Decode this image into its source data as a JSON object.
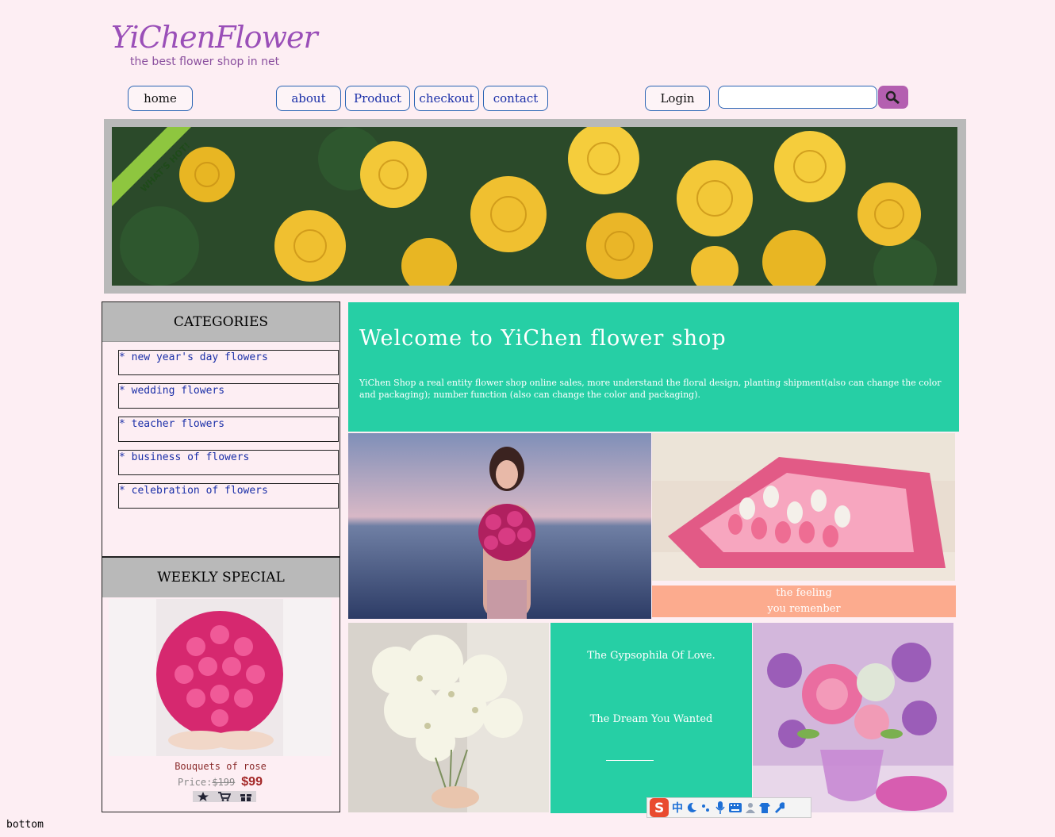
{
  "logo": {
    "title": "YiChenFlower",
    "subtitle": "the best flower shop in net"
  },
  "nav": {
    "home": "home",
    "about": "about",
    "product": "Product",
    "checkout": "checkout",
    "contact": "contact",
    "login": "Login",
    "search_placeholder": ""
  },
  "banner": {
    "ribbon": "WHAT'S HOT!"
  },
  "categories": {
    "title": "CATEGORIES",
    "items": [
      "* new year's day flowers",
      "* wedding flowers",
      "* teacher flowers",
      "* business of flowers",
      "* celebration of flowers"
    ]
  },
  "weekly": {
    "title": "WEEKLY SPECIAL",
    "product_name": "Bouquets of rose",
    "price_label": "Price:",
    "old_price": "$199",
    "new_price": "$99"
  },
  "welcome": {
    "title": "Welcome to YiChen flower shop",
    "text": "YiChen Shop a real entity flower shop online sales, more understand the floral design, planting shipment(also can change the color and packaging); number function (also can change the color and packaging)."
  },
  "feeling": {
    "line1": "the feeling",
    "line2": "you remenber"
  },
  "gypsophila": {
    "line1": "The Gypsophila Of Love.",
    "line2": "The Dream You Wanted"
  },
  "ime": {
    "label": "中"
  },
  "footer": {
    "text": "bottom"
  },
  "colors": {
    "accent": "#26cfa5",
    "background": "#fdeef3",
    "nav_text": "#1a2fa8",
    "search_button": "#b45fb0"
  }
}
